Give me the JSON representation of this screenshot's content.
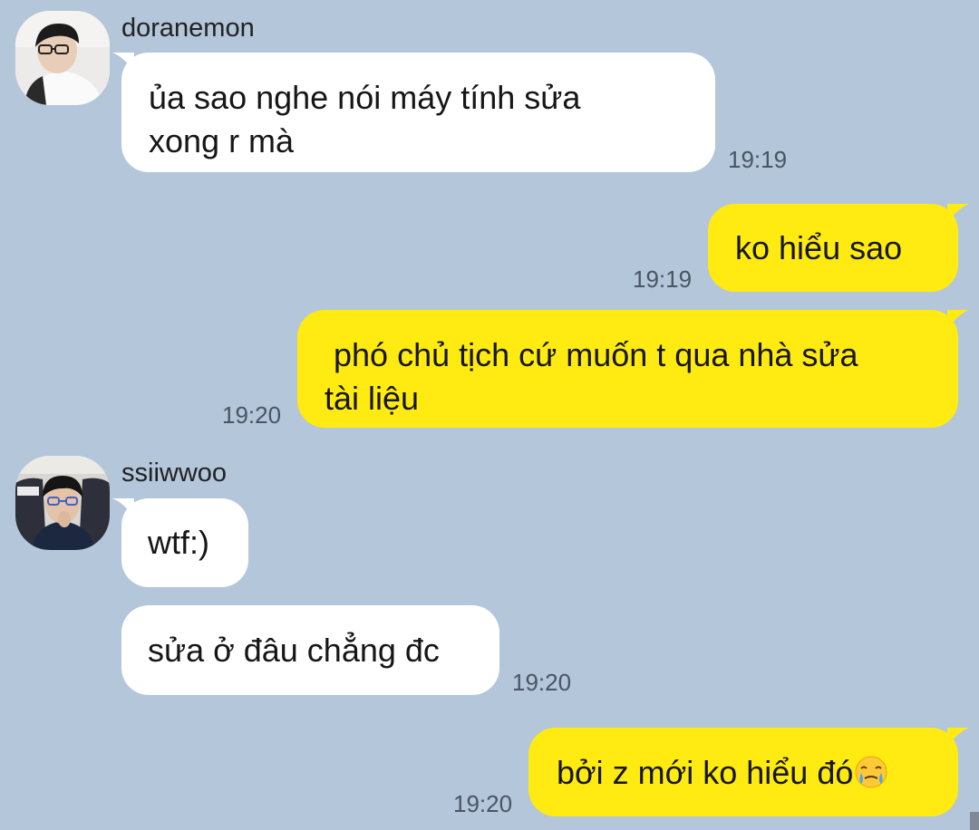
{
  "chat": {
    "messages": [
      {
        "sender": "doranemon",
        "lines": [
          "ủa sao nghe nói máy tính sửa",
          "xong r mà"
        ],
        "time": "19:19"
      },
      {
        "sender": "me",
        "lines": [
          "ko hiểu sao"
        ],
        "time": "19:19"
      },
      {
        "sender": "me",
        "lines": [
          " phó chủ tịch cứ muốn t qua nhà sửa",
          "tài liệu"
        ],
        "time": "19:20"
      },
      {
        "sender": "ssiiwwoo",
        "lines": [
          "wtf:)"
        ],
        "time": ""
      },
      {
        "sender": "ssiiwwoo",
        "lines": [
          "sửa ở đâu chẳng đc"
        ],
        "time": "19:20"
      },
      {
        "sender": "me",
        "lines": [
          "bởi z mới ko hiểu đó"
        ],
        "emoji": "face-holding-back-tears-emoji",
        "time": "19:20"
      }
    ],
    "senders": {
      "doranemon": {
        "name": "doranemon"
      },
      "ssiiwwoo": {
        "name": "ssiiwwoo"
      }
    }
  },
  "theme": {
    "background": "#b3c6da",
    "incoming_bubble": "#ffffff",
    "outgoing_bubble": "#ffeb12",
    "time_color": "#4a5563"
  }
}
